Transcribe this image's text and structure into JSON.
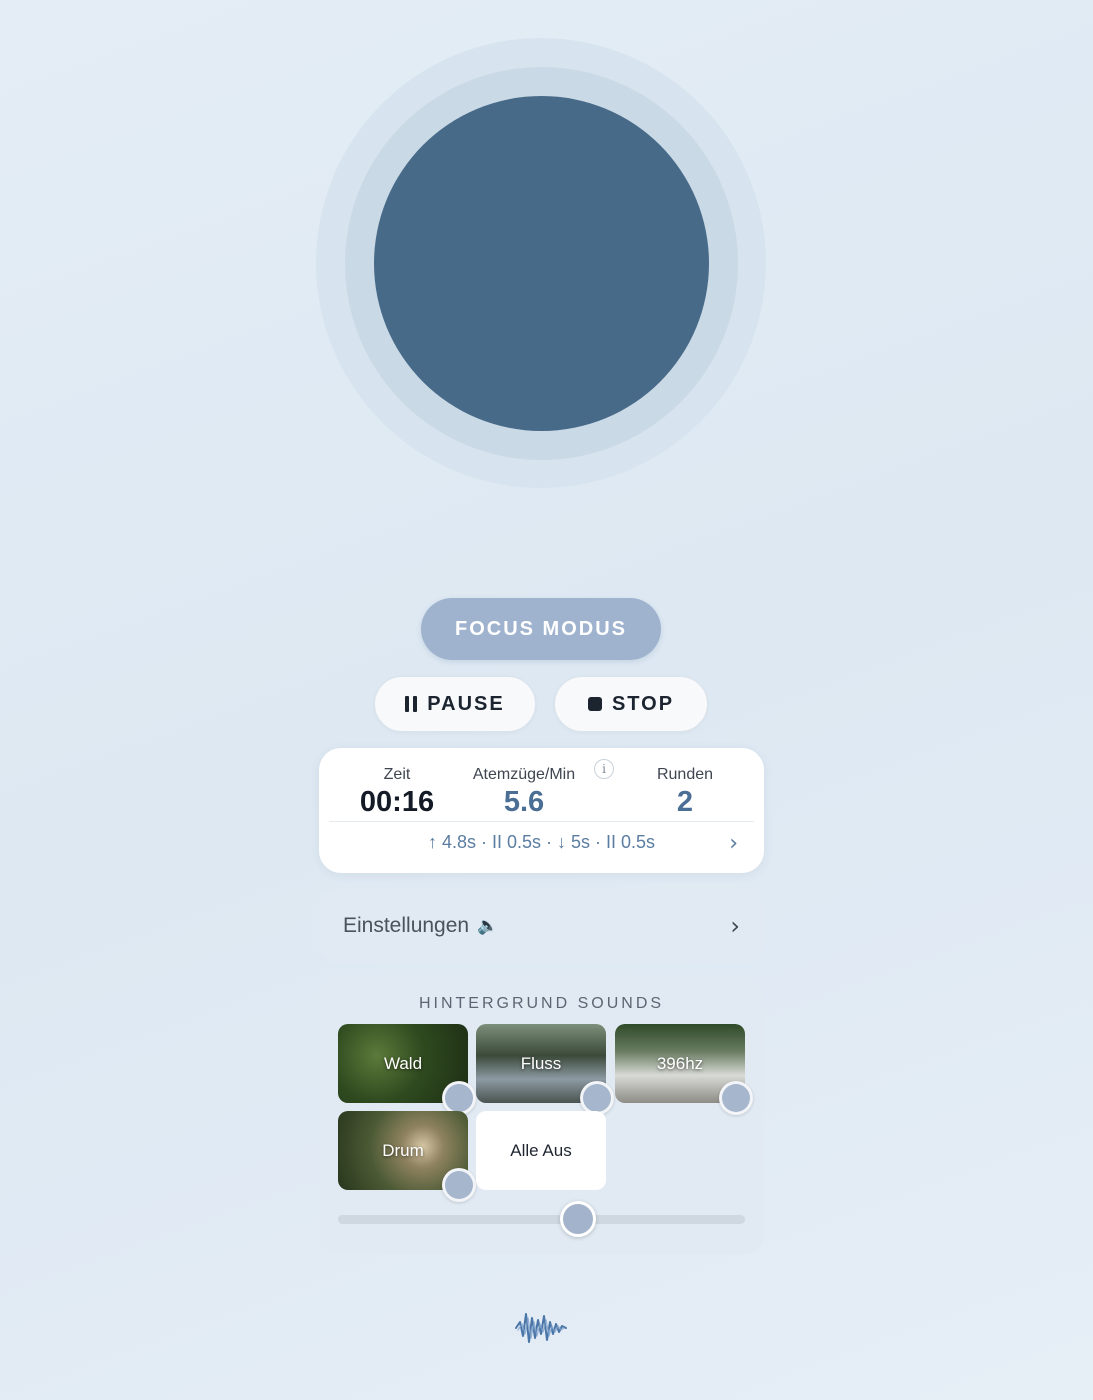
{
  "focus": {
    "label": "FOCUS MODUS"
  },
  "controls": {
    "pause_label": "PAUSE",
    "stop_label": "STOP"
  },
  "stats": {
    "time_label": "Zeit",
    "time_value": "00:16",
    "bpm_label": "Atemzüge/Min",
    "bpm_value": "5.6",
    "info_glyph": "i",
    "rounds_label": "Runden",
    "rounds_value": "2",
    "pattern": "↑ 4.8s · II 0.5s · ↓ 5s · II 0.5s",
    "chevron": "›"
  },
  "settings": {
    "label": "Einstellungen",
    "icon": "🔈",
    "chevron": "›"
  },
  "sounds": {
    "title": "HINTERGRUND SOUNDS",
    "tiles": [
      {
        "label": "Wald"
      },
      {
        "label": "Fluss"
      },
      {
        "label": "396hz"
      },
      {
        "label": "Drum"
      }
    ],
    "all_off_label": "Alle Aus",
    "volume_percent": 59
  },
  "colors": {
    "orb_core": "#476a88",
    "accent": "#4b6f94",
    "focus_button": "#9fb3cf"
  },
  "icons": {
    "pause": "pause-icon",
    "stop": "stop-icon",
    "info": "info-icon",
    "speaker": "speaker-icon",
    "logo": "waveform-logo-icon"
  }
}
